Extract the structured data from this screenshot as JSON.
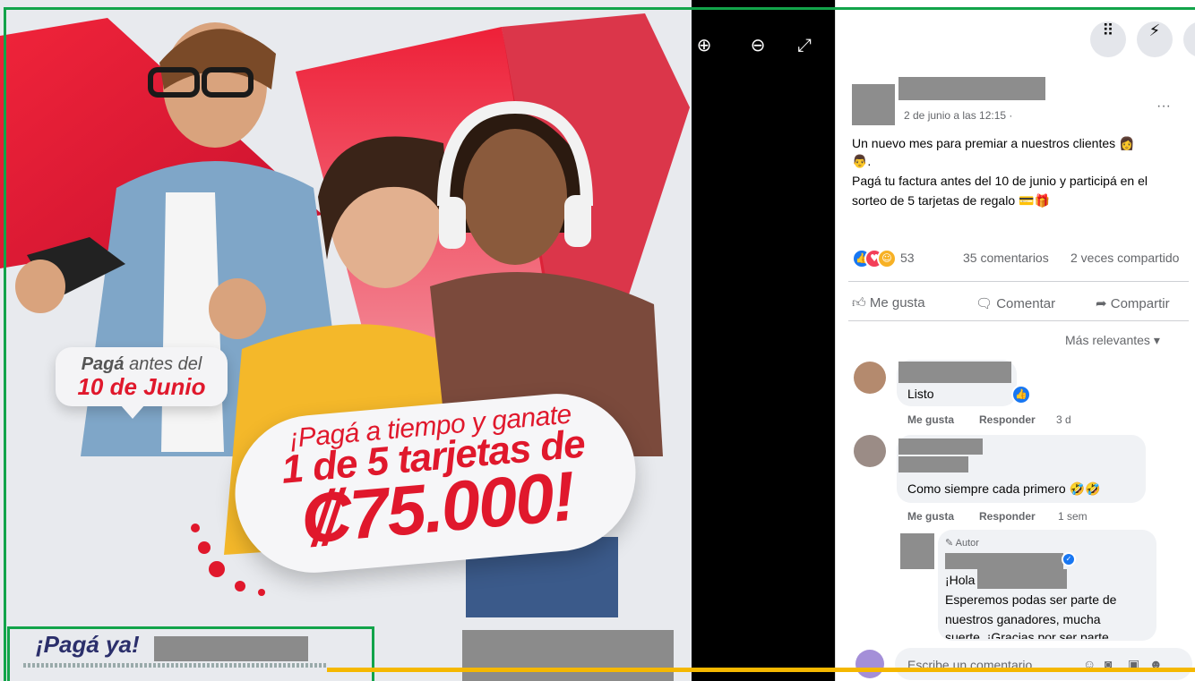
{
  "viewer": {
    "zoom_in": "⊕",
    "zoom_out": "⊖",
    "fullscreen": "⤢"
  },
  "promo": {
    "badge_bold": "Pagá",
    "badge_rest": " antes del",
    "badge_date": "10 de Junio",
    "pill_line1": "¡Pagá a tiempo y ganate",
    "pill_line2": "1 de 5 tarjetas de",
    "pill_line3": "₡75.000!",
    "footer_brand": "¡Pagá ya!"
  },
  "header": {
    "apps_icon": "⠿",
    "messenger_icon": "⚡"
  },
  "post": {
    "timestamp": "2 de junio a las 12:15 ·",
    "more": "···",
    "text_line1": "Un nuevo mes para premiar a nuestros clientes",
    "text_line2": "Pagá tu factura antes del 10 de junio y participá en el",
    "text_line3": "sorteo de 5 tarjetas de regalo",
    "reaction_count": "53",
    "comments_count": "35 comentarios",
    "shares_count": "2 veces compartido",
    "like_label": "Me gusta",
    "comment_label": "Comentar",
    "share_label": "Compartir",
    "sort_label": "Más relevantes"
  },
  "comments": [
    {
      "text": "Listo",
      "like": "Me gusta",
      "reply": "Responder",
      "time": "3 d"
    },
    {
      "text": "Como siempre cada primero",
      "like": "Me gusta",
      "reply": "Responder",
      "time": "1 sem"
    }
  ],
  "reply": {
    "author_badge": "Autor",
    "line1": "¡Hola",
    "line2": "Esperemos podas ser parte de",
    "line3": "nuestros ganadores, mucha",
    "line4": "suerte. ¡Gracias por ser parte"
  },
  "composer": {
    "placeholder": "Escribe un comentario..."
  },
  "colors": {
    "brand_red": "#e0182c",
    "fb_blue": "#1877f2",
    "annotation_green": "#12a44a",
    "annotation_orange": "#f5b800"
  }
}
